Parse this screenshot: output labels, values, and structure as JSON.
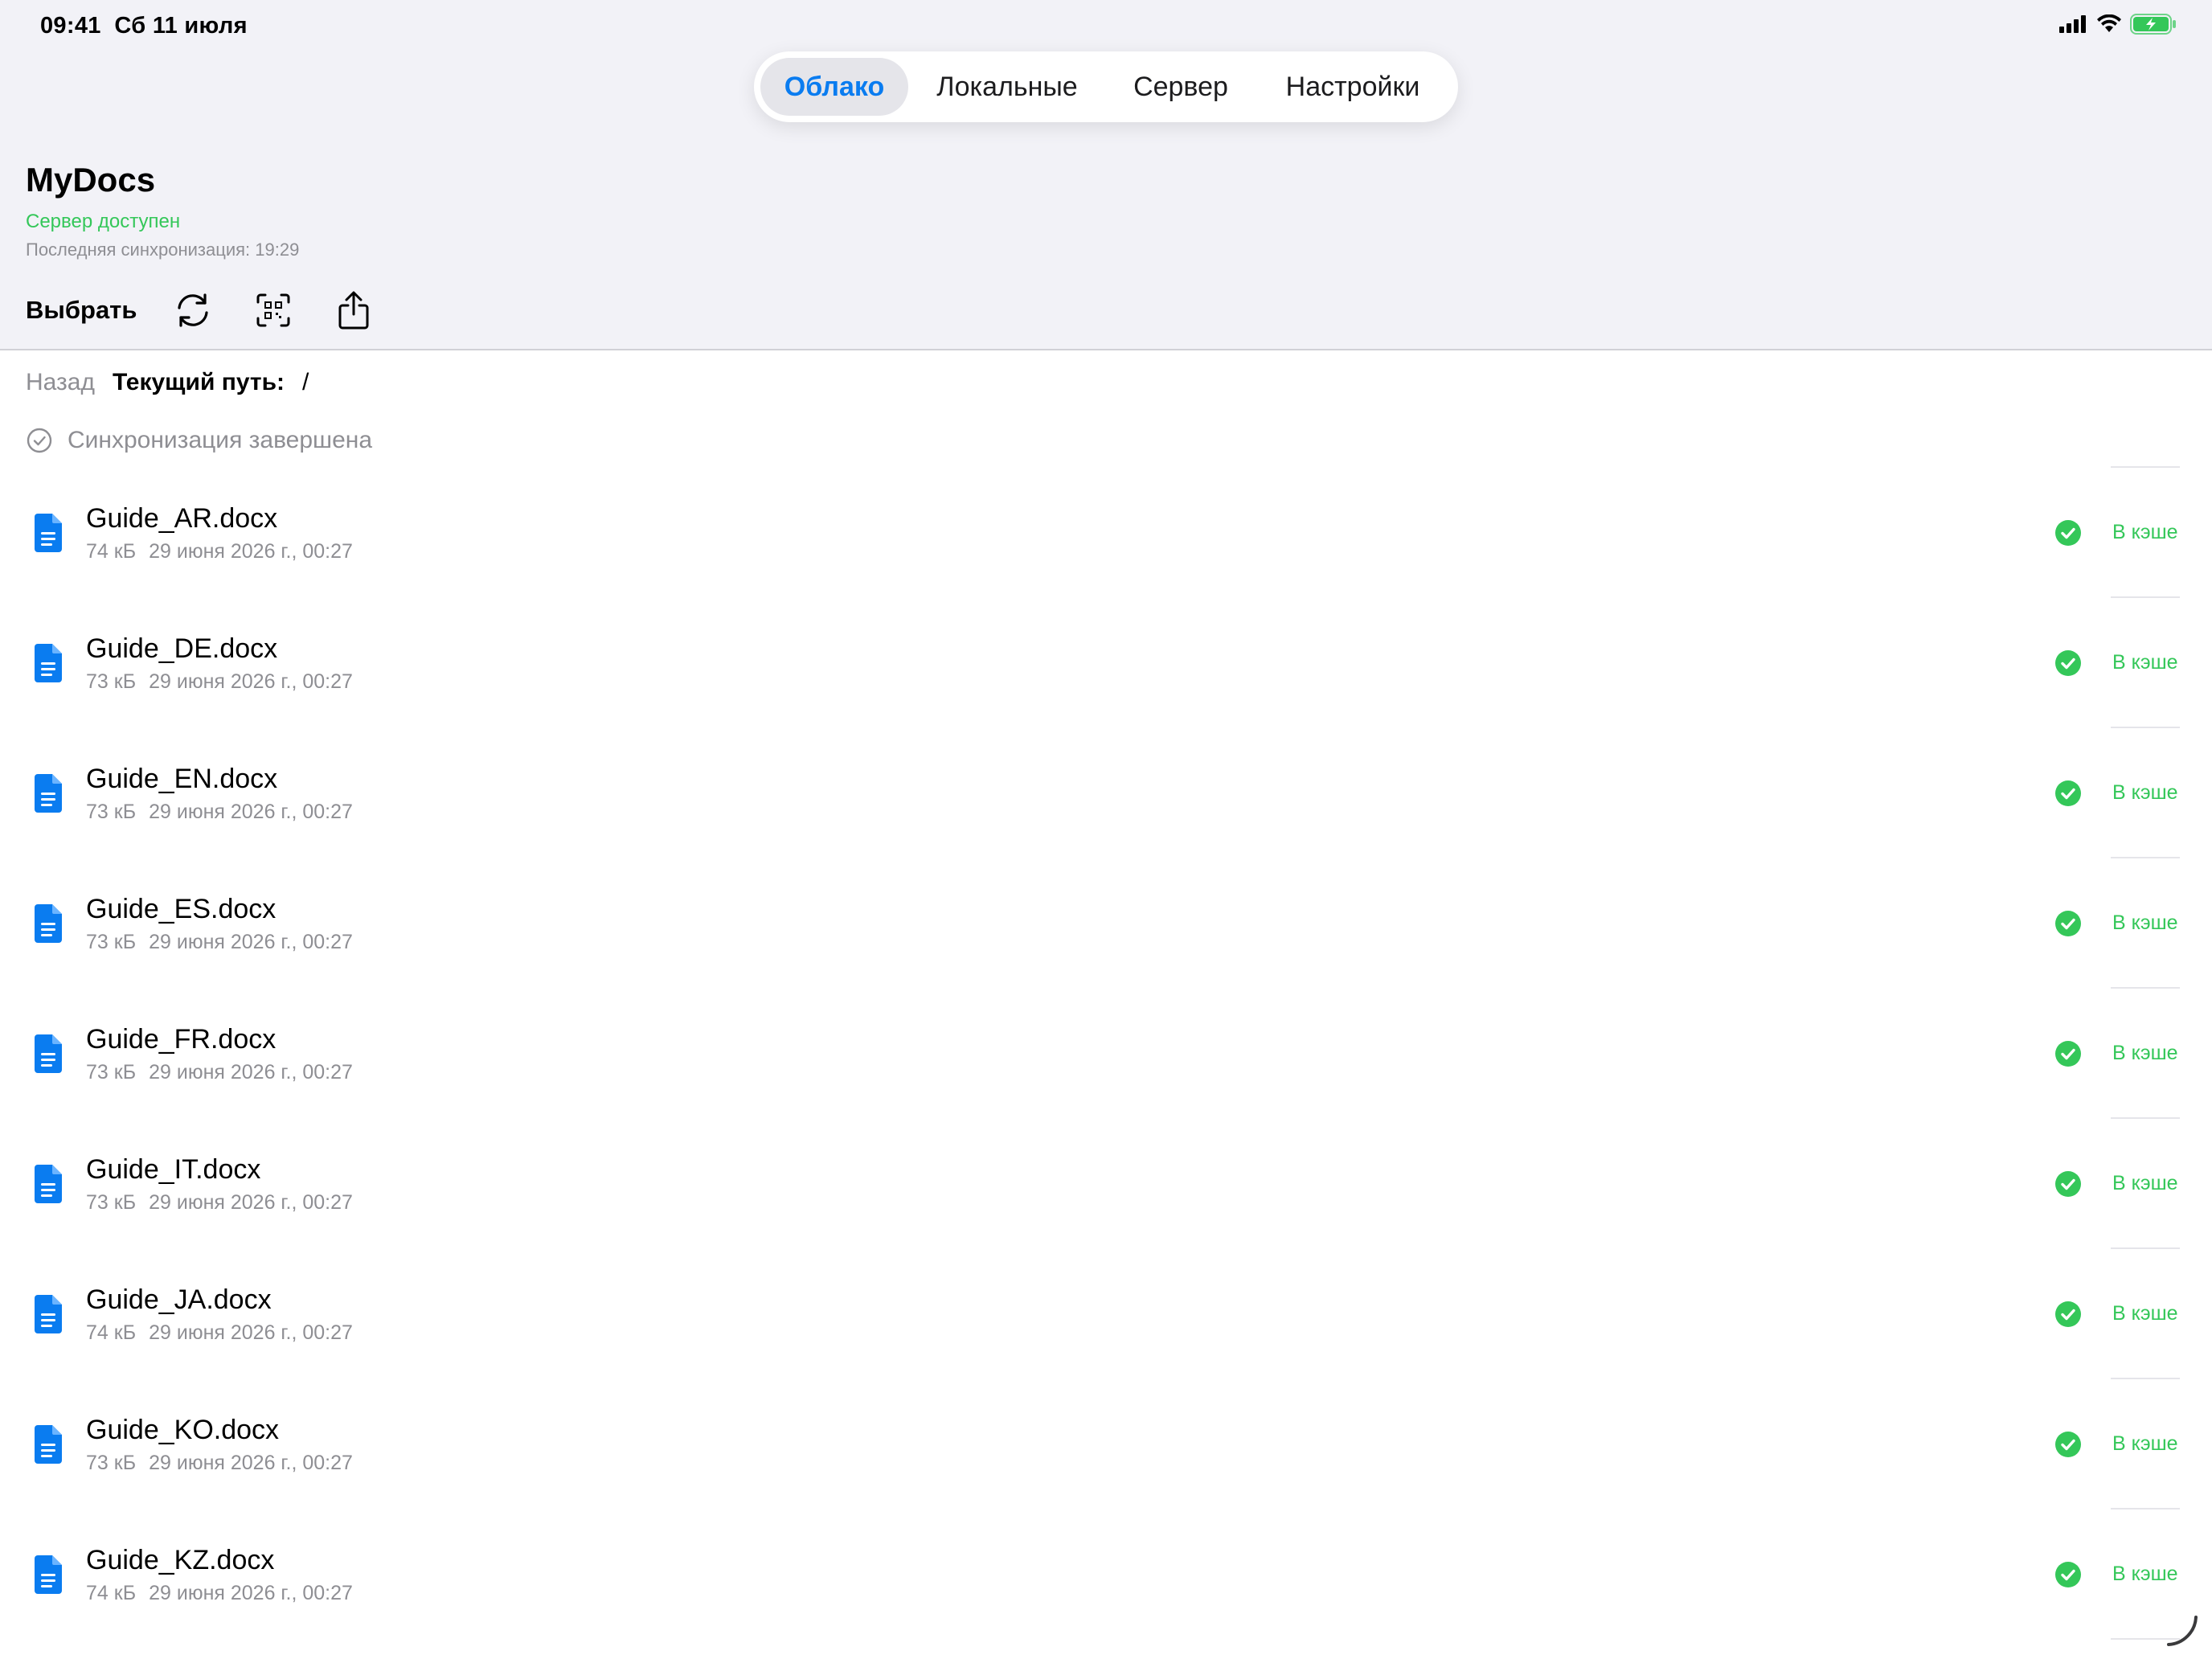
{
  "status_bar": {
    "time": "09:41",
    "date": "Сб 11 июля"
  },
  "tabs": [
    {
      "label": "Облако",
      "active": true
    },
    {
      "label": "Локальные",
      "active": false
    },
    {
      "label": "Сервер",
      "active": false
    },
    {
      "label": "Настройки",
      "active": false
    }
  ],
  "header": {
    "title": "MyDocs",
    "server_status": "Сервер доступен",
    "last_sync": "Последняя синхронизация: 19:29"
  },
  "toolbar": {
    "select_label": "Выбрать",
    "icons": [
      "sync-icon",
      "qr-scan-icon",
      "share-icon"
    ]
  },
  "navigation": {
    "back_label": "Назад",
    "path_label": "Текущий путь:",
    "path_value": "/"
  },
  "sync_status": "Синхронизация завершена",
  "files": [
    {
      "name": "Guide_AR.docx",
      "size": "74 кБ",
      "date": "29 июня 2026 г., 00:27",
      "status": "В кэше"
    },
    {
      "name": "Guide_DE.docx",
      "size": "73 кБ",
      "date": "29 июня 2026 г., 00:27",
      "status": "В кэше"
    },
    {
      "name": "Guide_EN.docx",
      "size": "73 кБ",
      "date": "29 июня 2026 г., 00:27",
      "status": "В кэше"
    },
    {
      "name": "Guide_ES.docx",
      "size": "73 кБ",
      "date": "29 июня 2026 г., 00:27",
      "status": "В кэше"
    },
    {
      "name": "Guide_FR.docx",
      "size": "73 кБ",
      "date": "29 июня 2026 г., 00:27",
      "status": "В кэше"
    },
    {
      "name": "Guide_IT.docx",
      "size": "73 кБ",
      "date": "29 июня 2026 г., 00:27",
      "status": "В кэше"
    },
    {
      "name": "Guide_JA.docx",
      "size": "74 кБ",
      "date": "29 июня 2026 г., 00:27",
      "status": "В кэше"
    },
    {
      "name": "Guide_KO.docx",
      "size": "73 кБ",
      "date": "29 июня 2026 г., 00:27",
      "status": "В кэше"
    },
    {
      "name": "Guide_KZ.docx",
      "size": "74 кБ",
      "date": "29 июня 2026 г., 00:27",
      "status": "В кэше"
    }
  ],
  "colors": {
    "accent": "#0a7cf0",
    "success": "#34c759",
    "secondary_text": "#8e8e93",
    "header_bg": "#f2f2f7"
  }
}
